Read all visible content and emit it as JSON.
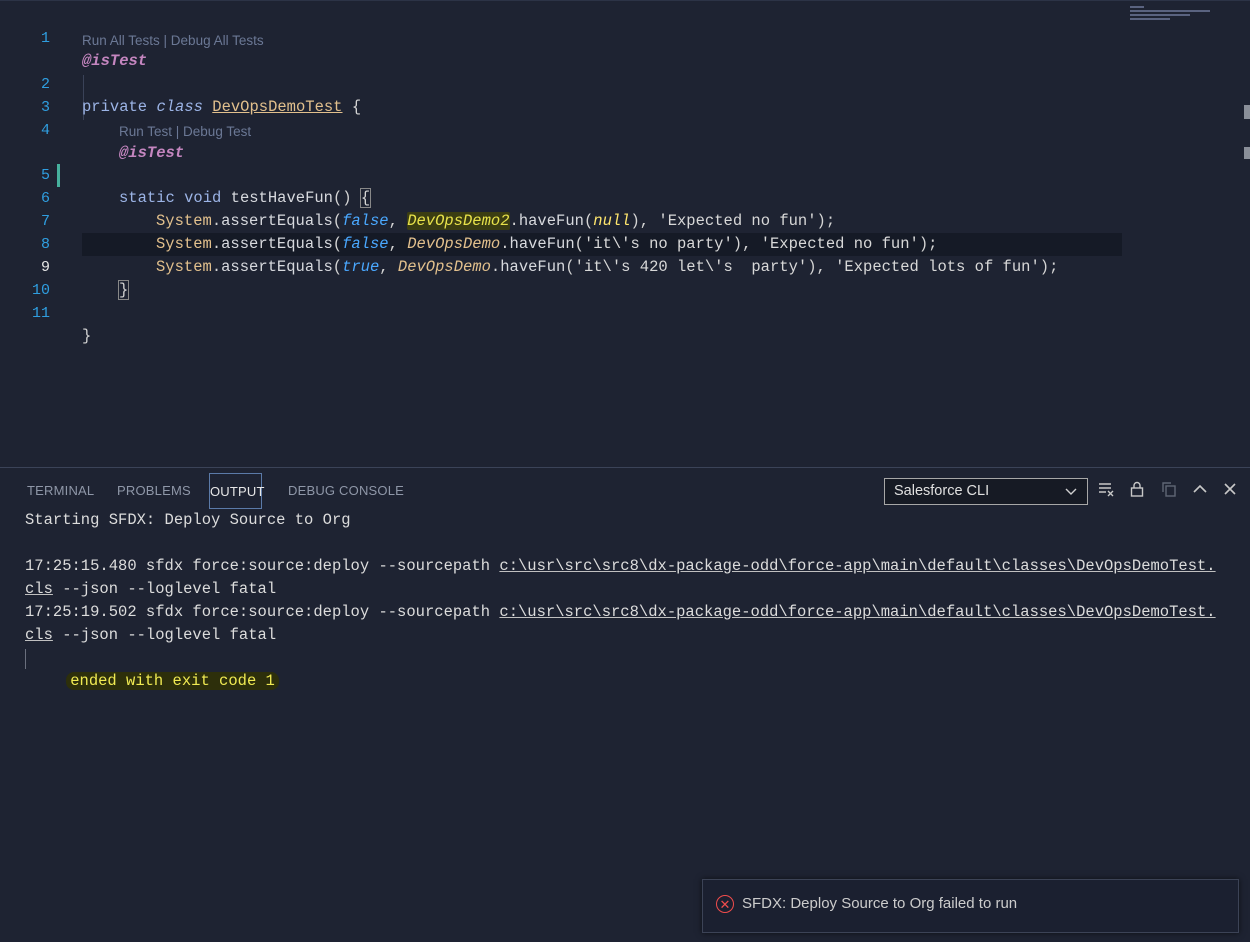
{
  "editor": {
    "lines": [
      {
        "num": "1"
      },
      {
        "num": "2"
      },
      {
        "num": "3"
      },
      {
        "num": "4"
      },
      {
        "num": "5"
      },
      {
        "num": "6"
      },
      {
        "num": "7"
      },
      {
        "num": "8"
      },
      {
        "num": "9"
      },
      {
        "num": "10"
      },
      {
        "num": "11"
      }
    ],
    "code_lens": {
      "class_lens": "Run All Tests | Debug All Tests",
      "method_lens": "Run Test | Debug Test"
    },
    "tokens": {
      "annotation": "@isTest",
      "private": "private",
      "class": "class",
      "class_name": "DevOpsDemoTest",
      "open_brace": "{",
      "close_brace": "}",
      "static": "static",
      "void": "void",
      "method_name": "testHaveFun",
      "parens": "()",
      "system": "System",
      "dot": ".",
      "assert": "assertEquals",
      "lparen": "(",
      "comma": ", ",
      "false": "false",
      "true": "true",
      "null": "null",
      "demo2": "DevOpsDemo2",
      "demo": "DevOpsDemo",
      "haveFun": "haveFun",
      "str_expected_no_fun": "'Expected no fun'",
      "str_no_party": "'it\\'s no party'",
      "str_420": "'it\\'s 420 let\\'s  party'",
      "str_lots": "'Expected lots of fun'",
      "close_call": ");",
      "close_paren": ")"
    }
  },
  "panel": {
    "tabs": [
      {
        "label": "TERMINAL"
      },
      {
        "label": "PROBLEMS"
      },
      {
        "label": "OUTPUT",
        "active": true
      },
      {
        "label": "DEBUG CONSOLE"
      }
    ],
    "channel_select": "Salesforce CLI",
    "icons": [
      "clear-output-icon",
      "lock-icon",
      "copy-icon",
      "maximize-icon",
      "close-icon"
    ],
    "output": {
      "line1": "Starting SFDX: Deploy Source to Org",
      "cmd1_prefix": "17:25:15.480 sfdx force:source:deploy --sourcepath ",
      "cmd2_prefix": "17:25:19.502 sfdx force:source:deploy --sourcepath ",
      "path_part1": "c:\\usr\\src\\src8\\dx-package-odd\\force-app\\main\\default\\classes\\DevOpsDemoTest.",
      "path_part2": "cls",
      "cmd_suffix": " --json --loglevel fatal",
      "exit_line": "ended with exit code 1"
    }
  },
  "notification": {
    "message": "SFDX: Deploy Source to Org failed to run",
    "severity_color": "#f14c4c"
  }
}
